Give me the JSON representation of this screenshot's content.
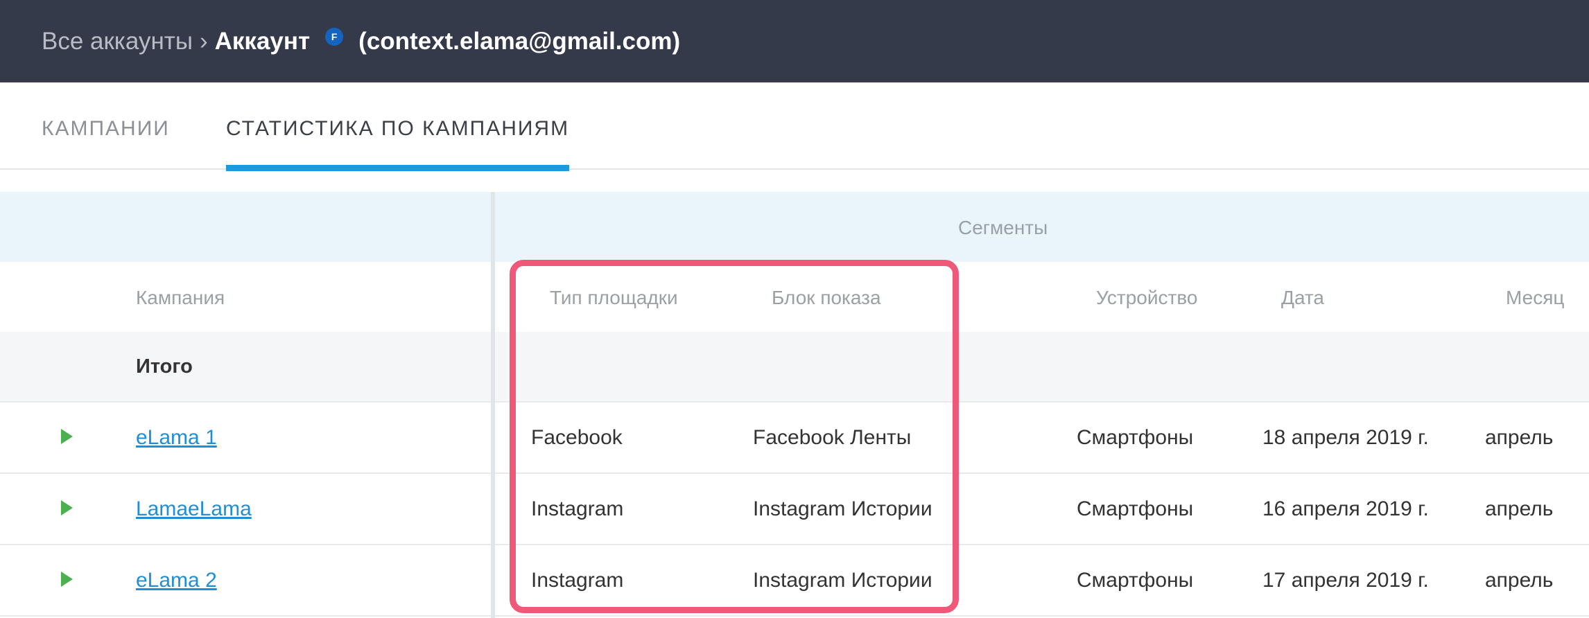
{
  "breadcrumb": {
    "all_accounts": "Все аккаунты",
    "separator": "›",
    "account_label": "Аккаунт",
    "account_badge": "F",
    "account_email": "(context.elama@gmail.com)"
  },
  "tabs": [
    {
      "label": "КАМПАНИИ",
      "active": false
    },
    {
      "label": "СТАТИСТИКА ПО КАМПАНИЯМ",
      "active": true
    }
  ],
  "table": {
    "segments_title": "Сегменты",
    "columns": {
      "campaign": "Кампания",
      "placement_type": "Тип площадки",
      "ad_block": "Блок показа",
      "device": "Устройство",
      "date": "Дата",
      "month": "Месяц"
    },
    "total_label": "Итого",
    "rows": [
      {
        "campaign": "eLama 1",
        "placement_type": "Facebook",
        "ad_block": "Facebook Ленты",
        "device": "Смартфоны",
        "date": "18 апреля 2019 г.",
        "month": "апрель"
      },
      {
        "campaign": "LamaeLama",
        "placement_type": "Instagram",
        "ad_block": "Instagram Истории",
        "device": "Смартфоны",
        "date": "16 апреля 2019 г.",
        "month": "апрель"
      },
      {
        "campaign": "eLama 2",
        "placement_type": "Instagram",
        "ad_block": "Instagram Истории",
        "device": "Смартфоны",
        "date": "17 апреля 2019 г.",
        "month": "апрель"
      }
    ]
  },
  "colors": {
    "header_bg": "#343a4a",
    "tab_underline": "#1a9be0",
    "segments_bg": "#eaf4fb",
    "highlight_border": "#f0587a",
    "play_icon": "#4caf50",
    "link": "#1e8fd6"
  },
  "icons": {
    "row_status": "play-icon",
    "account_badge": "facebook-badge-icon"
  }
}
